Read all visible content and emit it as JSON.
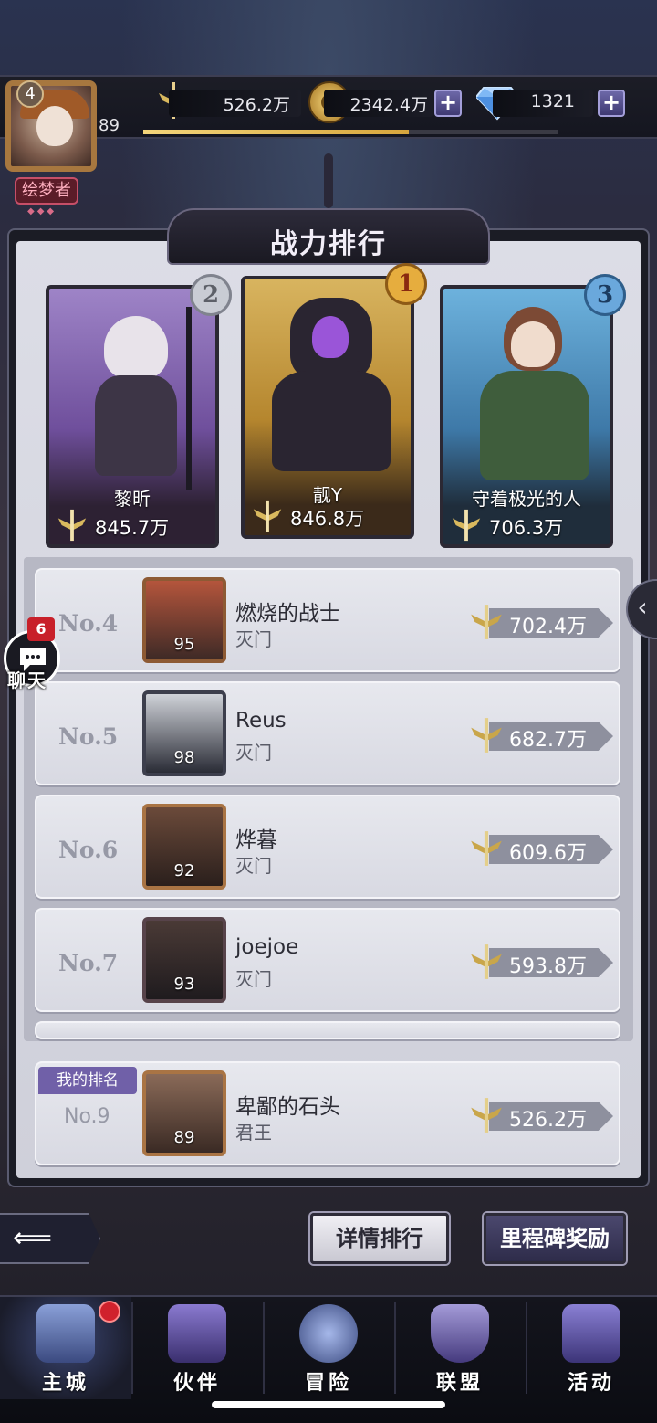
{
  "topbar": {
    "power": "526.2万",
    "gold": "2342.4万",
    "gems": "1321",
    "player_level": "89",
    "avatar_rank": "4",
    "player_title": "绘梦者",
    "xp_fraction": 0.64
  },
  "panel": {
    "title": "战力排行"
  },
  "podium": [
    {
      "rank": "2",
      "name": "黎昕",
      "power": "845.7万"
    },
    {
      "rank": "1",
      "name": "靓Y",
      "power": "846.8万"
    },
    {
      "rank": "3",
      "name": "守着极光的人",
      "power": "706.3万"
    }
  ],
  "ranking": [
    {
      "rank": "No.4",
      "name": "燃烧的战士",
      "guild": "灭门",
      "level": "95",
      "power": "702.4万"
    },
    {
      "rank": "No.5",
      "name": "Reus",
      "guild": "灭门",
      "level": "98",
      "power": "682.7万"
    },
    {
      "rank": "No.6",
      "name": "烨暮",
      "guild": "灭门",
      "level": "92",
      "power": "609.6万"
    },
    {
      "rank": "No.7",
      "name": "joejoe",
      "guild": "灭门",
      "level": "93",
      "power": "593.8万"
    }
  ],
  "my_rank": {
    "tag": "我的排名",
    "rank": "No.9",
    "name": "卑鄙的石头",
    "guild": "君王",
    "level": "89",
    "power": "526.2万"
  },
  "chat": {
    "badge": "6",
    "label": "聊天"
  },
  "buttons": {
    "detail": "详情排行",
    "milestone": "里程碑奖励"
  },
  "nav": [
    {
      "label": "主城",
      "icon": "castle-icon"
    },
    {
      "label": "伙伴",
      "icon": "wizard-hat-icon"
    },
    {
      "label": "冒险",
      "icon": "compass-icon"
    },
    {
      "label": "联盟",
      "icon": "shield-icon"
    },
    {
      "label": "活动",
      "icon": "cards-icon"
    }
  ],
  "colors": {
    "gold_medal": "#d9a23a",
    "silver_medal": "#b9bcc6",
    "bronze_medal": "#5a93c4",
    "accent": "#7060a8"
  }
}
